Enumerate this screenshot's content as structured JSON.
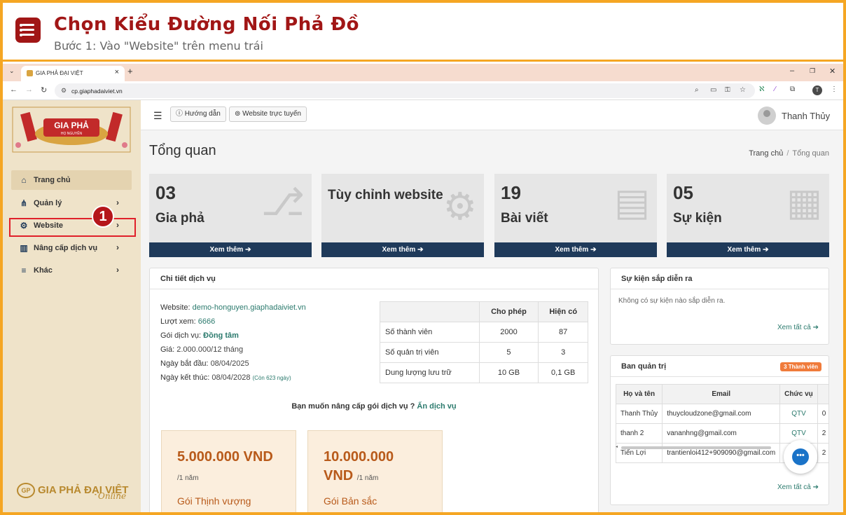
{
  "header": {
    "title": "Chọn Kiểu Đường Nối Phả Đồ",
    "subtitle": "Bước 1: Vào \"Website\" trên menu trái"
  },
  "browser": {
    "tab_title": "GIA PHẢ ĐẠI VIỆT",
    "url": "cp.giaphadaiviet.vn",
    "profile_initial": "T"
  },
  "sidebar": {
    "items": [
      {
        "label": "Trang chủ",
        "icon": "home-icon"
      },
      {
        "label": "Quản lý",
        "icon": "sitemap-icon"
      },
      {
        "label": "Website",
        "icon": "gear-icon"
      },
      {
        "label": "Nâng cấp dịch vụ",
        "icon": "bars-icon"
      },
      {
        "label": "Khác",
        "icon": "list-icon"
      }
    ],
    "step_badge": "1",
    "logo_banner": "GIA PHẢ",
    "logo_sub": "HỌ NGUYỄN",
    "footer_logo": "GIA PHẢ ĐẠI VIỆT",
    "footer_logo_badge": "GP",
    "footer_online": "Online"
  },
  "topbar": {
    "guide_label": "Hướng dẫn",
    "website_label": "Website trực tuyến",
    "user_name": "Thanh Thủy"
  },
  "page": {
    "title": "Tổng quan",
    "breadcrumb": [
      "Trang chủ",
      "Tổng quan"
    ]
  },
  "cards": [
    {
      "number": "03",
      "label": "Gia phả",
      "footer": "Xem thêm",
      "icon": "sitemap-icon"
    },
    {
      "number": "",
      "label": "Tùy chỉnh website",
      "footer": "Xem thêm",
      "icon": "gears-icon"
    },
    {
      "number": "19",
      "label": "Bài viết",
      "footer": "Xem thêm",
      "icon": "newspaper-icon"
    },
    {
      "number": "05",
      "label": "Sự kiện",
      "footer": "Xem thêm",
      "icon": "calendar-icon"
    }
  ],
  "service": {
    "title": "Chi tiết dịch vụ",
    "website_label": "Website:",
    "website_value": "demo-honguyen.giaphadaiviet.vn",
    "views_label": "Lượt xem:",
    "views_value": "6666",
    "plan_label": "Gói dịch vụ:",
    "plan_value": "Đồng tâm",
    "price_label": "Giá:",
    "price_value": "2.000.000/12 tháng",
    "start_label": "Ngày bắt đầu:",
    "start_value": "08/04/2025",
    "end_label": "Ngày kết thúc:",
    "end_value": "08/04/2028",
    "remaining": "(Còn 623 ngày)",
    "table": {
      "headers": [
        "",
        "Cho phép",
        "Hiện có"
      ],
      "rows": [
        [
          "Số thành viên",
          "2000",
          "87"
        ],
        [
          "Số quản trị viên",
          "5",
          "3"
        ],
        [
          "Dung lượng lưu trữ",
          "10 GB",
          "0,1 GB"
        ]
      ]
    },
    "upgrade_text": "Bạn muốn nâng cấp gói dịch vụ ?",
    "upgrade_link": "Ấn dịch vụ",
    "packages": [
      {
        "price": "5.000.000 VND",
        "unit": "/1 năm",
        "name": "Gói Thịnh vượng"
      },
      {
        "price_line1": "10.000.000",
        "price_line2": "VND",
        "unit": "/1 năm",
        "name": "Gói Bản sắc"
      }
    ]
  },
  "events": {
    "title": "Sự kiện sắp diễn ra",
    "empty": "Không có sự kiện nào sắp diễn ra.",
    "see_all": "Xem tất cả"
  },
  "admins": {
    "title": "Ban quản trị",
    "badge": "3 Thành viên",
    "headers": [
      "Họ và tên",
      "Email",
      "Chức vụ",
      ""
    ],
    "rows": [
      [
        "Thanh Thủy",
        "thuycloudzone@gmail.com",
        "QTV",
        "0"
      ],
      [
        "thanh 2",
        "vananhng@gmail.com",
        "QTV",
        "2"
      ],
      [
        "Tiến Lợi",
        "trantienloi412+909090@gmail.com",
        "",
        "2"
      ]
    ],
    "see_all": "Xem tất cả"
  },
  "colors": {
    "brand": "#a11616",
    "accent": "#f5a623",
    "navy": "#1f3a5a",
    "teal": "#2b7a6d"
  }
}
